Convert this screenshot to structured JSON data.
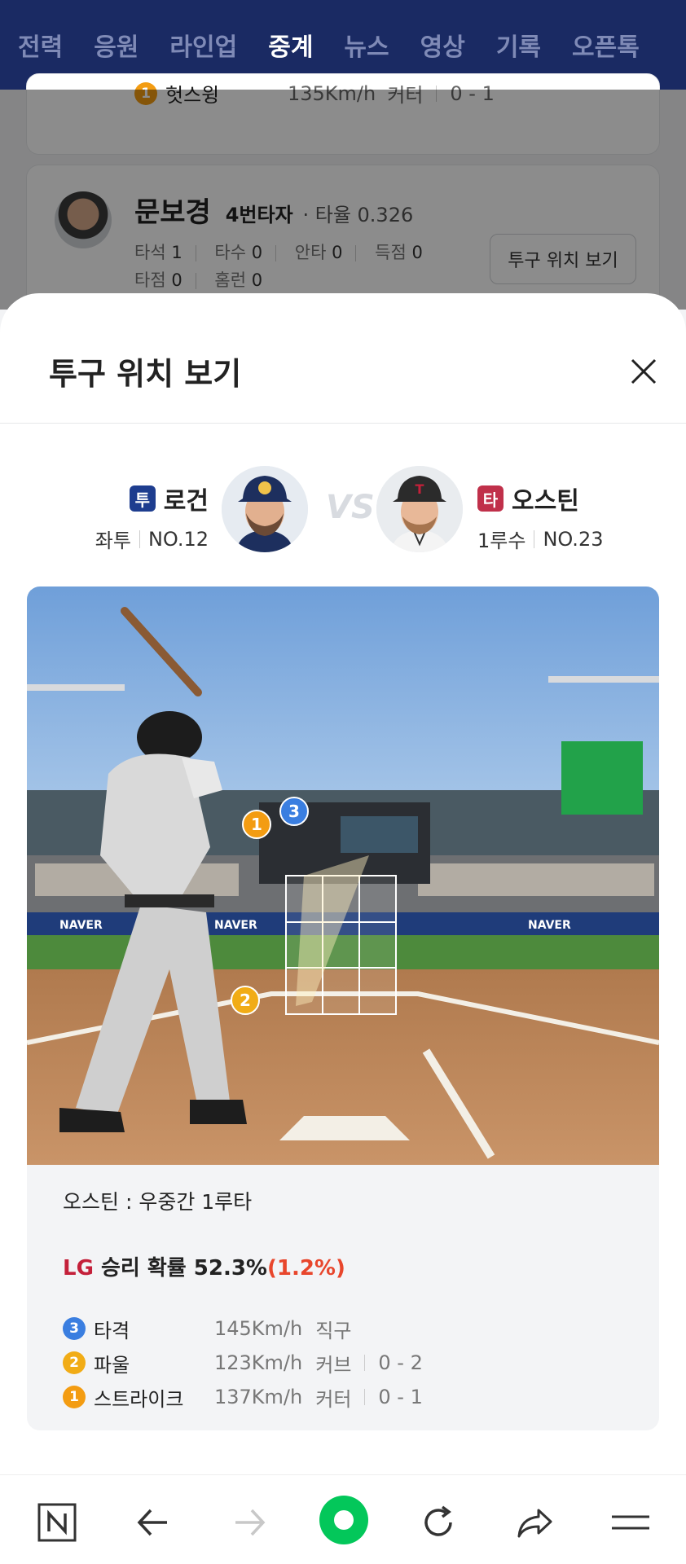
{
  "tabs": [
    {
      "label": "전력",
      "active": false
    },
    {
      "label": "응원",
      "active": false
    },
    {
      "label": "라인업",
      "active": false
    },
    {
      "label": "중계",
      "active": true
    },
    {
      "label": "뉴스",
      "active": false
    },
    {
      "label": "영상",
      "active": false
    },
    {
      "label": "기록",
      "active": false
    },
    {
      "label": "오픈톡",
      "active": false
    }
  ],
  "background": {
    "prev_pitch": {
      "num": "1",
      "label": "헛스윙",
      "speed": "135Km/h",
      "type": "커터",
      "count": "0 - 1"
    },
    "batter": {
      "name": "문보경",
      "order": "4번타자",
      "avg_label": "타율 0.326",
      "stats_row1": [
        {
          "k": "타석",
          "v": "1"
        },
        {
          "k": "타수",
          "v": "0"
        },
        {
          "k": "안타",
          "v": "0"
        },
        {
          "k": "득점",
          "v": "0"
        }
      ],
      "stats_row2": [
        {
          "k": "타점",
          "v": "0"
        },
        {
          "k": "홈런",
          "v": "0"
        }
      ],
      "button": "투구 위치 보기"
    }
  },
  "sheet": {
    "title": "투구 위치 보기",
    "pitcher": {
      "role": "투",
      "name": "로건",
      "hand": "좌투",
      "number": "NO.12"
    },
    "vs": "VS",
    "hitter": {
      "role": "타",
      "name": "오스틴",
      "position": "1루수",
      "number": "NO.23"
    },
    "zone_markers": [
      "1",
      "3",
      "2"
    ],
    "result": "오스틴 : 우중간 1루타",
    "win_prob": {
      "team": "LG",
      "label": "승리 확률 52.3%",
      "delta": "(1.2%)"
    },
    "pitches": [
      {
        "num": "3",
        "result": "타격",
        "speed": "145Km/h",
        "type": "직구",
        "count": ""
      },
      {
        "num": "2",
        "result": "파울",
        "speed": "123Km/h",
        "type": "커브",
        "count": "0 - 2"
      },
      {
        "num": "1",
        "result": "스트라이크",
        "speed": "137Km/h",
        "type": "커터",
        "count": "0 - 1"
      }
    ]
  },
  "nav_icons": [
    "naver-home-icon",
    "back-icon",
    "forward-icon",
    "green-dot-icon",
    "refresh-icon",
    "share-icon",
    "menu-icon"
  ],
  "colors": {
    "header_bg": "#1a2a63",
    "pitcher_badge": "#1e3d8f",
    "hitter_badge": "#c0304a",
    "lg_red": "#c4203a",
    "accent_green": "#03c75a"
  }
}
